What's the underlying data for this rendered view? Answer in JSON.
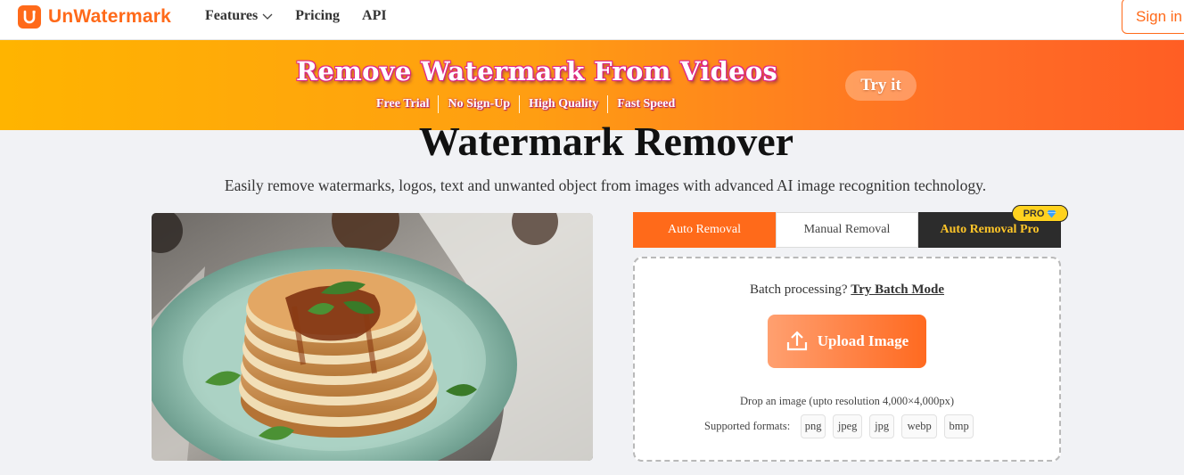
{
  "nav": {
    "brand": "UnWatermark",
    "links": [
      {
        "label": "Features"
      },
      {
        "label": "Pricing"
      },
      {
        "label": "API"
      }
    ],
    "signin": "Sign in"
  },
  "banner": {
    "title": "Remove Watermark From Videos",
    "features": [
      "Free Trial",
      "No Sign-Up",
      "High Quality",
      "Fast Speed"
    ],
    "cta": "Try it"
  },
  "hero": {
    "title": "Watermark Remover",
    "subtitle": "Easily remove watermarks, logos, text and unwanted object from images with advanced AI image recognition technology."
  },
  "tabs": {
    "auto": "Auto Removal",
    "manual": "Manual Removal",
    "pro": "Auto Removal Pro",
    "pro_badge": "PRO"
  },
  "upload": {
    "batch_text": "Batch processing?",
    "batch_link": "Try Batch Mode",
    "button": "Upload Image",
    "drop_text": "Drop an image (upto resolution 4,000×4,000px)",
    "formats_label": "Supported formats:",
    "formats": [
      "png",
      "jpeg",
      "jpg",
      "webp",
      "bmp"
    ]
  },
  "colors": {
    "accent": "#ff6a1a",
    "pro_tab": "#2c2c2c",
    "pro_text": "#ffc629"
  }
}
